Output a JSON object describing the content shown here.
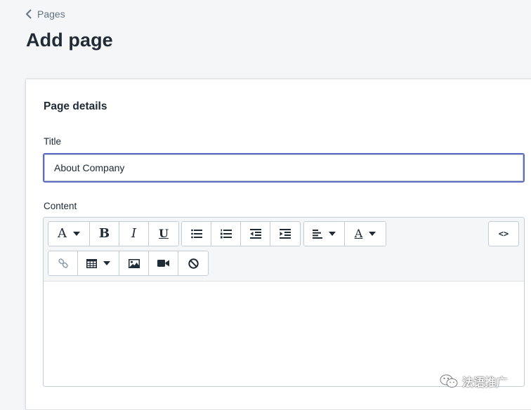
{
  "breadcrumb": {
    "label": "Pages",
    "icon": "chevron-left-icon"
  },
  "page": {
    "title": "Add page"
  },
  "card": {
    "title": "Page details",
    "title_field": {
      "label": "Title",
      "value": "About Company"
    },
    "content_field": {
      "label": "Content"
    }
  },
  "toolbar": {
    "row1": [
      [
        "text-style-dropdown",
        "bold",
        "italic",
        "underline"
      ],
      [
        "bullet-list",
        "numbered-list",
        "outdent",
        "indent"
      ],
      [
        "align-dropdown",
        "text-color-dropdown"
      ]
    ],
    "row2": [
      [
        "link",
        "table-dropdown",
        "image",
        "video",
        "clear-formatting"
      ]
    ],
    "glyphs": {
      "text_style": "A",
      "bold": "B",
      "italic": "I",
      "underline": "U",
      "text_color": "A"
    },
    "code_label": "<>"
  },
  "watermark": {
    "text": "法语推广",
    "icon": "wechat-icon"
  },
  "colors": {
    "background": "#f5f6f8",
    "card": "#ffffff",
    "focus_border": "#5c6ac4",
    "text": "#212b36",
    "muted": "#637381",
    "toolbar_bg": "#f4f6f8"
  }
}
